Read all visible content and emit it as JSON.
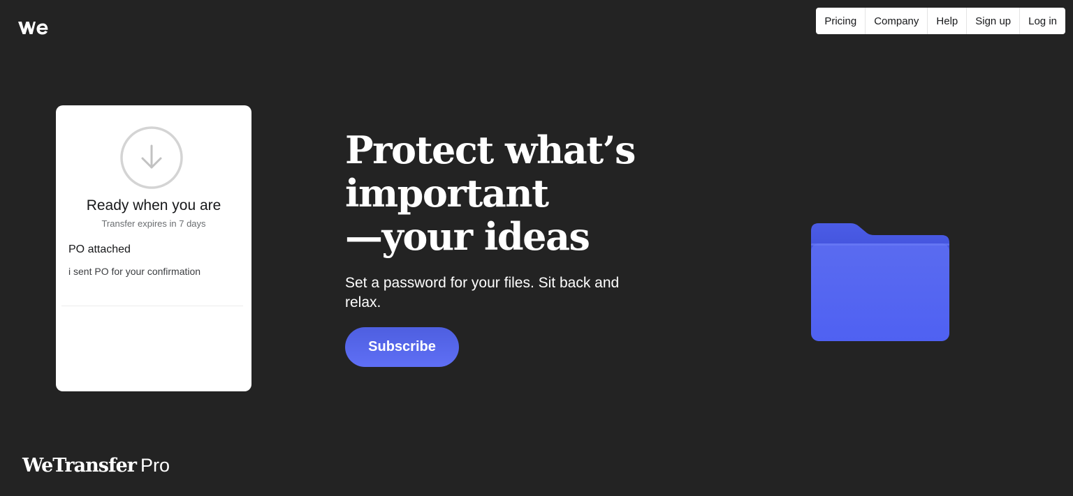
{
  "header": {
    "logo_icon": "wetransfer-we-logo-icon",
    "nav": [
      {
        "label": "Pricing"
      },
      {
        "label": "Company"
      },
      {
        "label": "Help"
      },
      {
        "label": "Sign up"
      },
      {
        "label": "Log in"
      }
    ]
  },
  "transfer_card": {
    "icon": "download-arrow-circle-icon",
    "title": "Ready when you are",
    "subtitle": "Transfer expires in 7 days",
    "message_title": "PO attached",
    "message_body": "i sent PO for your confirmation"
  },
  "hero": {
    "headline_line1": "Protect what’s",
    "headline_line2": "important",
    "headline_line3": "—your ideas",
    "subtext": "Set a password for your files. Sit back and relax.",
    "cta_label": "Subscribe",
    "illustration": "blue-folder-icon"
  },
  "footer": {
    "brand_name": "WeTransfer",
    "brand_suffix": "Pro"
  },
  "colors": {
    "background": "#232323",
    "accent": "#5565f0",
    "folder": "#5b6cf3",
    "card": "#ffffff"
  }
}
